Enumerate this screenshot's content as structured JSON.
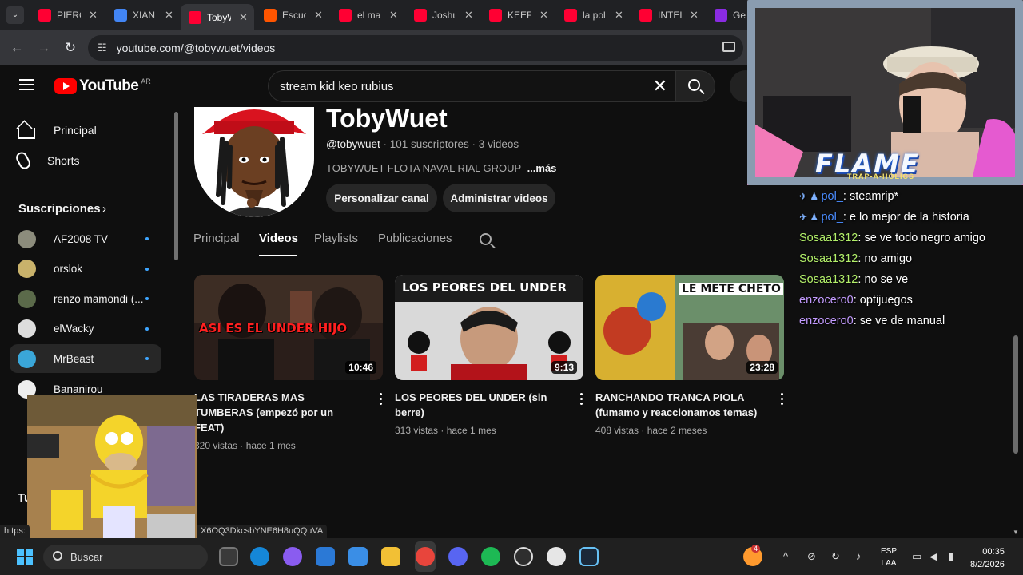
{
  "browser": {
    "tabs": [
      {
        "title": "PIERC",
        "color": "#ff0033"
      },
      {
        "title": "XIAN",
        "color": "#4285f4"
      },
      {
        "title": "TobyW",
        "color": "#ff0033"
      },
      {
        "title": "Escuc",
        "color": "#ff5500"
      },
      {
        "title": "el ma",
        "color": "#ff0033"
      },
      {
        "title": "Joshu",
        "color": "#ff0033"
      },
      {
        "title": "KEEF",
        "color": "#ff0033"
      },
      {
        "title": "la pol",
        "color": "#ff0033"
      },
      {
        "title": "INTEL",
        "color": "#ff0033"
      },
      {
        "title": "Geo",
        "color": "#8a2be2"
      }
    ],
    "active_tab_index": 2,
    "url": "youtube.com/@tobywuet/videos"
  },
  "youtube": {
    "logo_text": "YouTube",
    "country_code": "AR",
    "search_query": "stream kid keo rubius"
  },
  "sidebar": {
    "items": [
      {
        "label": "Principal",
        "icon": "home-icon"
      },
      {
        "label": "Shorts",
        "icon": "shorts-icon"
      }
    ],
    "subscriptions_title": "Suscripciones",
    "subscriptions": [
      {
        "name": "AF2008 TV",
        "color": "#8c8c7c"
      },
      {
        "name": "orslok",
        "color": "#c9b26b"
      },
      {
        "name": "renzo mamondi (...",
        "color": "#5b6a4a"
      },
      {
        "name": "elWacky",
        "color": "#dddddd"
      },
      {
        "name": "MrBeast",
        "color": "#3aa6d8"
      },
      {
        "name": "Bananirou",
        "color": "#eeeeee"
      }
    ],
    "partial_section_label": "Tu"
  },
  "channel": {
    "name": "TobyWuet",
    "handle": "@tobywuet",
    "stats": "· 101 suscriptores · 3 videos",
    "description": "TOBYWUET FLOTA NAVAL RIAL GROUP",
    "more_label": "...más",
    "customize_label": "Personalizar canal",
    "manage_label": "Administrar videos",
    "tabs": [
      "Principal",
      "Videos",
      "Playlists",
      "Publicaciones"
    ],
    "active_tab": "Videos"
  },
  "videos": [
    {
      "title": "LAS TIRADERAS MAS TUMBERAS (empezó por un FEAT)",
      "views": "320 vistas",
      "age": "hace 1 mes",
      "duration": "10:46",
      "thumb_text": "ASI ES EL UNDER HIJO"
    },
    {
      "title": "LOS PEORES DEL UNDER (sin berre)",
      "views": "313 vistas",
      "age": "hace 1 mes",
      "duration": "9:13",
      "thumb_text": "LOS PEORES DEL UNDER"
    },
    {
      "title": "RANCHANDO TRANCA PIOLA (fumamo y reaccionamos temas)",
      "views": "408 vistas",
      "age": "hace 2 meses",
      "duration": "23:28",
      "thumb_text": "LE METE CHETO"
    }
  ],
  "stream_overlay": {
    "banner_title": "FLAME",
    "banner_subtitle": "TRAP-A-HOLICS"
  },
  "chat": [
    {
      "user": "pol_",
      "message": "steamrip*",
      "color": "#4a8cff",
      "badges": true
    },
    {
      "user": "pol_",
      "message": "e lo mejor de la historia",
      "color": "#4a8cff",
      "badges": true
    },
    {
      "user": "Sosaa1312",
      "message": "se ve todo negro amigo",
      "color": "#b3f06a",
      "badges": false
    },
    {
      "user": "Sosaa1312",
      "message": "no amigo",
      "color": "#b3f06a",
      "badges": false
    },
    {
      "user": "Sosaa1312",
      "message": "no se ve",
      "color": "#b3f06a",
      "badges": false
    },
    {
      "user": "enzocero0",
      "message": "optijuegos",
      "color": "#c39bff",
      "badges": false
    },
    {
      "user": "enzocero0",
      "message": "se ve de manual",
      "color": "#c39bff",
      "badges": false
    }
  ],
  "status_bar": {
    "link_start": "https:",
    "link_end": "X6OQ3DkcsbYNE6H8uQQuVA"
  },
  "taskbar": {
    "search_placeholder": "Buscar",
    "language_top": "ESP",
    "language_bottom": "LAA",
    "time": "00:35",
    "date": "8/2/2026",
    "notification_badge": "4"
  }
}
